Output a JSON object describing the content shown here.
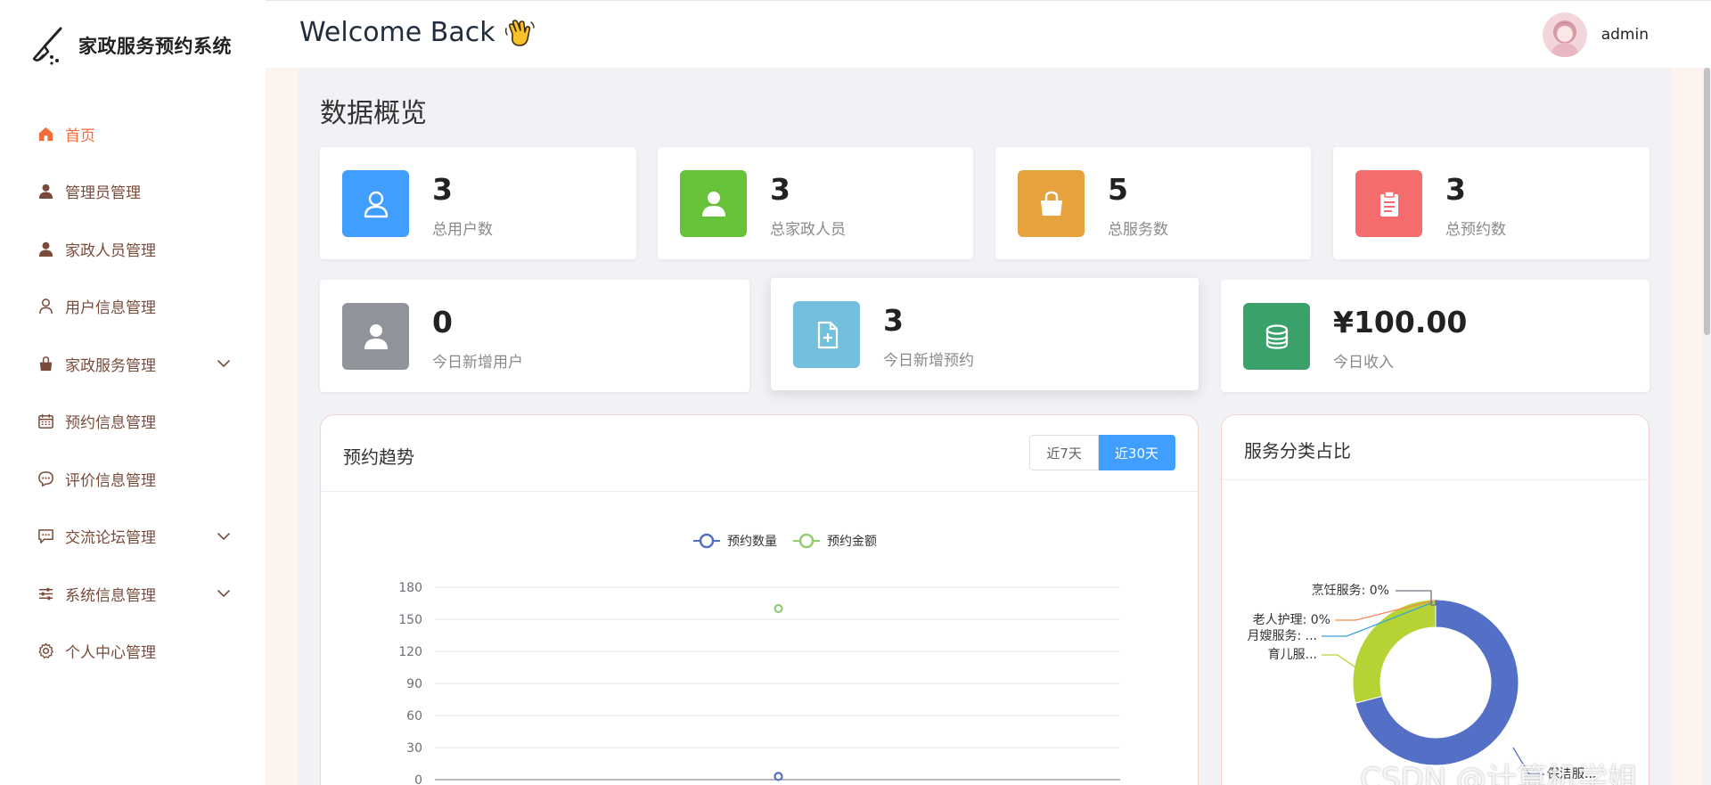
{
  "app": {
    "title": "家政服务预约系统"
  },
  "header": {
    "welcome": "Welcome Back",
    "username": "admin"
  },
  "sidebar": {
    "items": [
      {
        "label": "首页",
        "icon": "home-icon",
        "active": true
      },
      {
        "label": "管理员管理",
        "icon": "user-solid-icon"
      },
      {
        "label": "家政人员管理",
        "icon": "user-solid-icon"
      },
      {
        "label": "用户信息管理",
        "icon": "user-outline-icon"
      },
      {
        "label": "家政服务管理",
        "icon": "shopping-bag-icon",
        "expandable": true
      },
      {
        "label": "预约信息管理",
        "icon": "calendar-icon"
      },
      {
        "label": "评价信息管理",
        "icon": "chat-bubble-icon"
      },
      {
        "label": "交流论坛管理",
        "icon": "message-square-icon",
        "expandable": true
      },
      {
        "label": "系统信息管理",
        "icon": "sliders-icon",
        "expandable": true
      },
      {
        "label": "个人中心管理",
        "icon": "gear-icon"
      }
    ]
  },
  "overview": {
    "title": "数据概览",
    "row1": [
      {
        "value": "3",
        "label": "总用户数",
        "color": "#409eff",
        "icon": "user-outline-icon"
      },
      {
        "value": "3",
        "label": "总家政人员",
        "color": "#67c23a",
        "icon": "user-solid-icon"
      },
      {
        "value": "5",
        "label": "总服务数",
        "color": "#e6a23c",
        "icon": "shopping-bag-icon"
      },
      {
        "value": "3",
        "label": "总预约数",
        "color": "#f56c6c",
        "icon": "clipboard-icon"
      }
    ],
    "row2": [
      {
        "value": "0",
        "label": "今日新增用户",
        "color": "#909399",
        "icon": "user-solid-icon"
      },
      {
        "value": "3",
        "label": "今日新增预约",
        "color": "#73bfde",
        "icon": "document-add-icon"
      },
      {
        "value": "¥100.00",
        "label": "今日收入",
        "color": "#3aa16b",
        "icon": "coins-icon"
      }
    ]
  },
  "trend_panel": {
    "title": "预约趋势",
    "ranges": [
      "近7天",
      "近30天"
    ],
    "selected_range": "近30天"
  },
  "category_panel": {
    "title": "服务分类占比"
  },
  "chart_data": [
    {
      "type": "line",
      "series": [
        {
          "name": "预约数量",
          "color": "#5470c6",
          "values": [
            3
          ]
        },
        {
          "name": "预约金额",
          "color": "#91cc75",
          "values": [
            160
          ]
        }
      ],
      "yticks": [
        "180",
        "150",
        "120",
        "90",
        "60",
        "30",
        "0"
      ],
      "ylim": [
        0,
        180
      ],
      "legend": "top-center"
    },
    {
      "type": "pie",
      "donut": true,
      "slices": [
        {
          "label": "保洁服...",
          "value": 71,
          "color": "#5470c6"
        },
        {
          "label": "育儿服...",
          "value": 29,
          "color": "#b5d334"
        },
        {
          "label": "月嫂服务: ...",
          "value": 0,
          "color": "#3ba2d6"
        },
        {
          "label": "老人护理: 0%",
          "value": 0,
          "color": "#fc8452"
        },
        {
          "label": "烹饪服务: 0%",
          "value": 0,
          "color": "#73707d"
        }
      ]
    }
  ],
  "watermark": "CSDN @计算机学姐"
}
